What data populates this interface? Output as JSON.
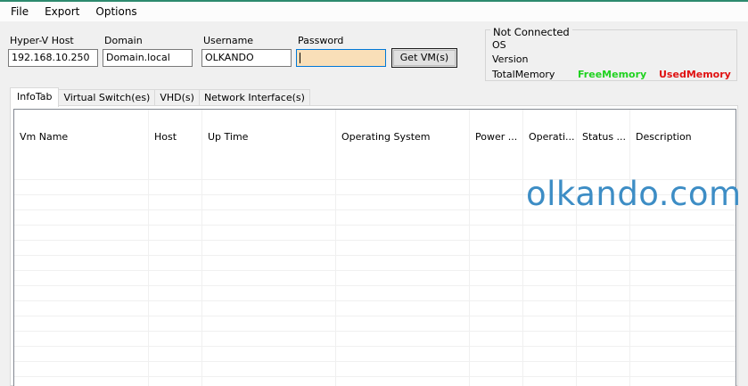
{
  "menu": {
    "items": [
      "File",
      "Export",
      "Options"
    ]
  },
  "connection": {
    "host_label": "Hyper-V Host",
    "host_value": "192.168.10.250",
    "domain_label": "Domain",
    "domain_value": "Domain.local",
    "username_label": "Username",
    "username_value": "OLKANDO",
    "password_label": "Password",
    "password_value": "",
    "get_vms_button": "Get VM(s)"
  },
  "status": {
    "title": "Not Connected",
    "os_label": "OS",
    "version_label": "Version",
    "total_memory_label": "TotalMemory",
    "free_memory_label": "FreeMemory",
    "used_memory_label": "UsedMemory",
    "colors": {
      "free": "#1fd21f",
      "used": "#e01010"
    }
  },
  "tabs": [
    "InfoTab",
    "Virtual Switch(es)",
    "VHD(s)",
    "Network Interface(s)"
  ],
  "active_tab": "InfoTab",
  "grid": {
    "columns": [
      "Vm Name",
      "Host",
      "Up Time",
      "Operating System",
      "Power ...",
      "Operati...",
      "Status ...",
      "Description"
    ]
  },
  "watermark": "olkando.com"
}
